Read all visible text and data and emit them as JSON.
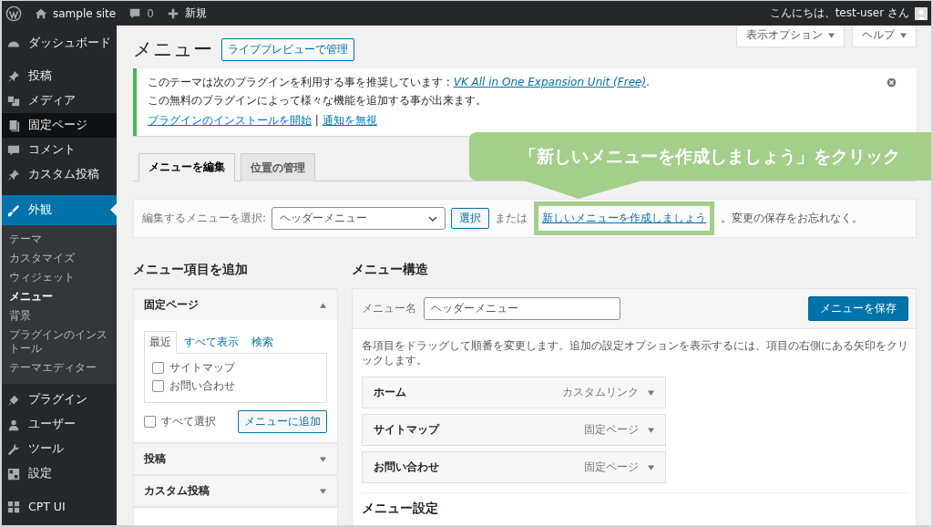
{
  "admin_bar": {
    "site_name": "sample site",
    "comments": "0",
    "new": "新規",
    "greeting": "こんにちは、test-user さん"
  },
  "sidebar": {
    "groups": [
      {
        "items": [
          {
            "label": "ダッシュボード",
            "selected": false,
            "hovered": false
          }
        ]
      },
      {
        "items": [
          {
            "label": "投稿",
            "selected": false,
            "hovered": false
          },
          {
            "label": "メディア",
            "selected": false,
            "hovered": false
          },
          {
            "label": "固定ページ",
            "selected": false,
            "hovered": true
          },
          {
            "label": "コメント",
            "selected": false,
            "hovered": false
          },
          {
            "label": "カスタム投稿",
            "selected": false,
            "hovered": false
          }
        ]
      },
      {
        "items": [
          {
            "label": "外観",
            "selected": true,
            "hovered": false,
            "children": [
              {
                "label": "テーマ",
                "selected": false
              },
              {
                "label": "カスタマイズ",
                "selected": false
              },
              {
                "label": "ウィジェット",
                "selected": false
              },
              {
                "label": "メニュー",
                "selected": true
              },
              {
                "label": "背景",
                "selected": false
              },
              {
                "label": "プラグインのインストール",
                "selected": false
              },
              {
                "label": "テーマエディター",
                "selected": false
              }
            ]
          },
          {
            "label": "プラグイン",
            "selected": false,
            "hovered": false
          },
          {
            "label": "ユーザー",
            "selected": false,
            "hovered": false
          },
          {
            "label": "ツール",
            "selected": false,
            "hovered": false
          },
          {
            "label": "設定",
            "selected": false,
            "hovered": false
          }
        ]
      },
      {
        "items": [
          {
            "label": "CPT UI",
            "selected": false,
            "hovered": false
          }
        ]
      }
    ]
  },
  "screen_meta": {
    "screen_options": "表示オプション",
    "help": "ヘルプ"
  },
  "page_title": "メニュー",
  "live_preview_button": "ライブプレビューで管理",
  "notice": {
    "line_1": "このテーマは次のプラグインを利用する事を推奨しています : ",
    "plugin_link": "VK All in One Expansion Unit (Free)",
    "line_1_end": ".",
    "line_2": "この無料のプラグインによって様々な機能を追加する事が出来ます。",
    "install_link": "プラグインのインストールを開始",
    "separator": "|",
    "dismiss_link": "通知を無視"
  },
  "tabs": [
    {
      "label": "メニューを編集",
      "selected": true
    },
    {
      "label": "位置の管理",
      "selected": false
    }
  ],
  "manage_bar": {
    "label": "編集するメニューを選択:",
    "select_value": "ヘッダーメニュー",
    "select_button": "選択",
    "or_text": "または",
    "create_link": "新しいメニューを作成しましょう",
    "after_text": "。変更の保存をお忘れなく。"
  },
  "callout": {
    "text": "「新しいメニューを作成しましょう」をクリック"
  },
  "add_items": {
    "title": "メニュー項目を追加",
    "sections": [
      {
        "title": "固定ページ",
        "expanded": true,
        "tabs": [
          {
            "label": "最近",
            "selected": true
          },
          {
            "label": "すべて表示",
            "selected": false
          },
          {
            "label": "検索",
            "selected": false
          }
        ],
        "items": [
          {
            "label": "サイトマップ",
            "checked": false
          },
          {
            "label": "お問い合わせ",
            "checked": false
          }
        ],
        "select_all": {
          "label": "すべて選択",
          "checked": false
        },
        "add_button": "メニューに追加"
      },
      {
        "title": "投稿",
        "expanded": false
      },
      {
        "title": "カスタム投稿",
        "expanded": false
      }
    ]
  },
  "structure": {
    "title": "メニュー構造",
    "name_label": "メニュー名",
    "name_value": "ヘッダーメニュー",
    "save_button": "メニューを保存",
    "instructions": "各項目をドラッグして順番を変更します。追加の設定オプションを表示するには、項目の右側にある矢印をクリックします。",
    "items": [
      {
        "title": "ホーム",
        "type": "カスタムリンク"
      },
      {
        "title": "サイトマップ",
        "type": "固定ページ"
      },
      {
        "title": "お問い合わせ",
        "type": "固定ページ"
      }
    ],
    "settings_title": "メニュー設定"
  }
}
